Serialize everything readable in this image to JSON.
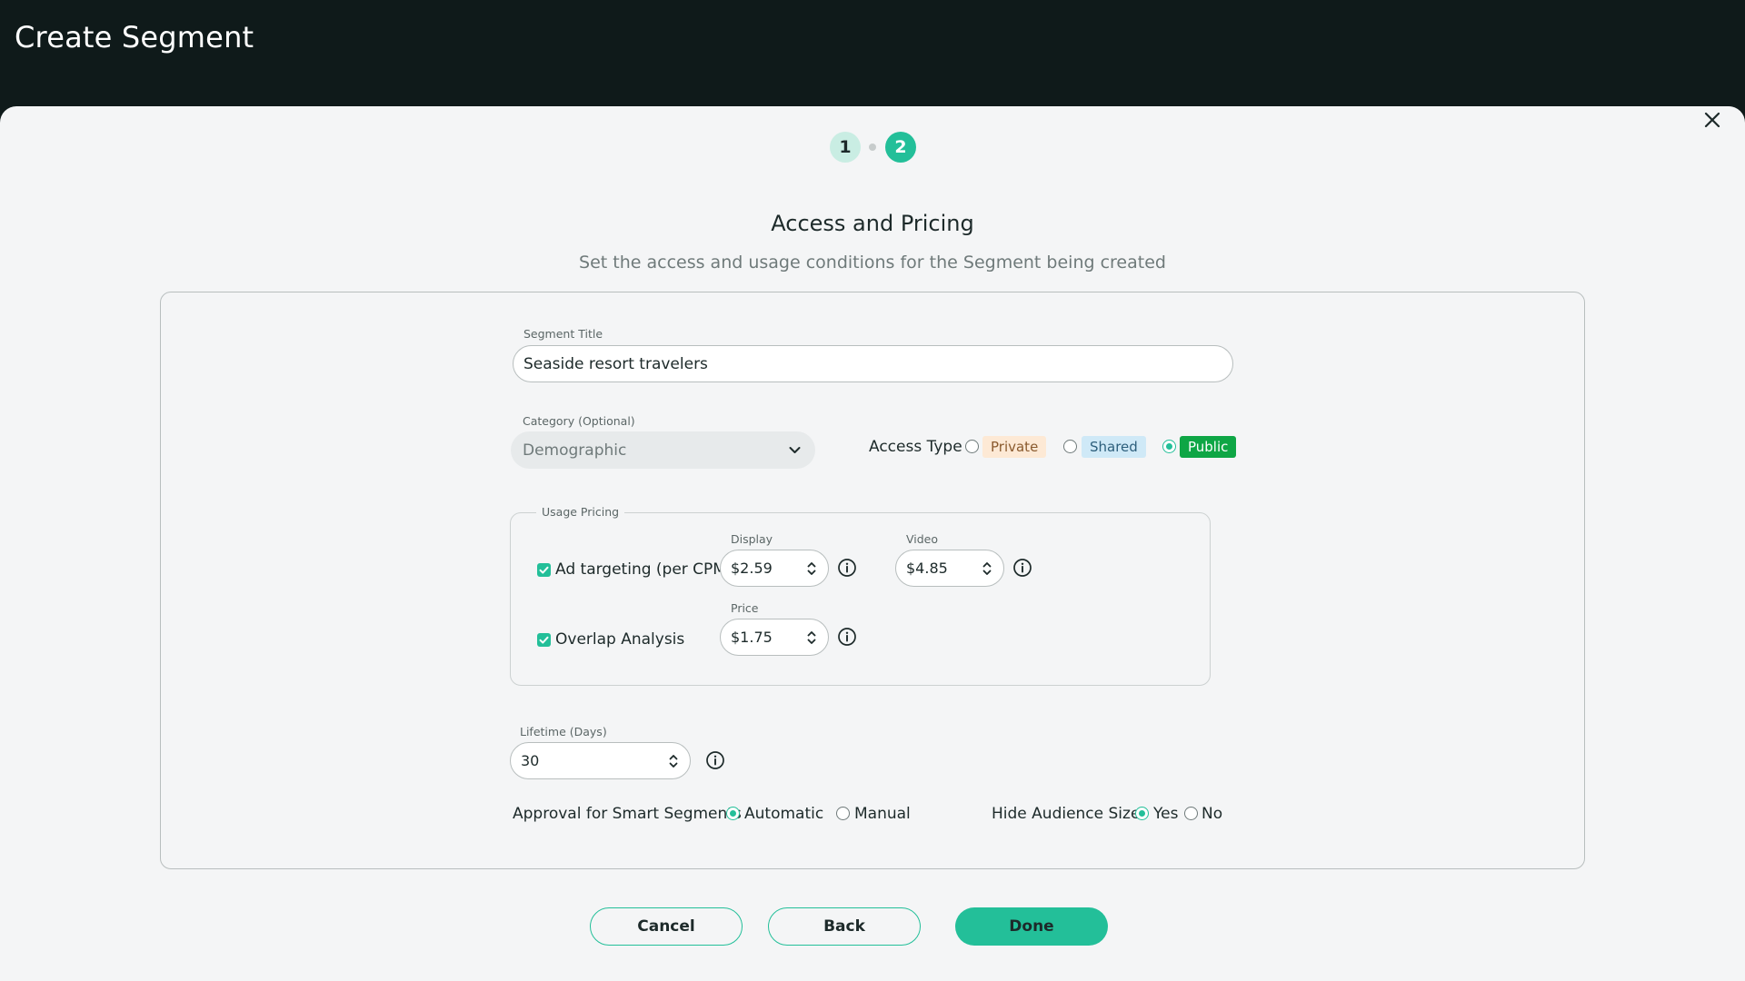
{
  "app": {
    "title": "Create Segment"
  },
  "stepper": {
    "steps": [
      "1",
      "2"
    ],
    "active_step": 2
  },
  "heading": {
    "title": "Access and Pricing",
    "subtitle": "Set the access and usage conditions for the Segment being created"
  },
  "segment_title": {
    "label": "Segment Title",
    "value": "Seaside resort travelers"
  },
  "category": {
    "label": "Category (Optional)",
    "selected": "Demographic"
  },
  "access_type": {
    "label": "Access Type",
    "options": [
      "Private",
      "Shared",
      "Public"
    ],
    "selected": "Public",
    "colors": {
      "private_bg": "#fde9d5",
      "shared_bg": "#cfe9f7",
      "public_bg": "#0ea645"
    }
  },
  "usage_pricing": {
    "legend": "Usage Pricing",
    "ad_targeting": {
      "label": "Ad targeting (per CPM)",
      "checked": true,
      "display_label": "Display",
      "display_value": "$2.59",
      "video_label": "Video",
      "video_value": "$4.85"
    },
    "overlap_analysis": {
      "label": "Overlap Analysis",
      "checked": true,
      "price_label": "Price",
      "price_value": "$1.75"
    }
  },
  "lifetime": {
    "label": "Lifetime (Days)",
    "value": "30"
  },
  "approval": {
    "label": "Approval for Smart Segments",
    "options": [
      "Automatic",
      "Manual"
    ],
    "selected": "Automatic"
  },
  "hide_audience_size": {
    "label": "Hide Audience Size",
    "options": [
      "Yes",
      "No"
    ],
    "selected": "Yes"
  },
  "actions": {
    "cancel": "Cancel",
    "back": "Back",
    "done": "Done"
  },
  "theme": {
    "accent": "#23bf99",
    "header_bg": "#0f1a1a",
    "page_bg": "#f4f5f6"
  }
}
